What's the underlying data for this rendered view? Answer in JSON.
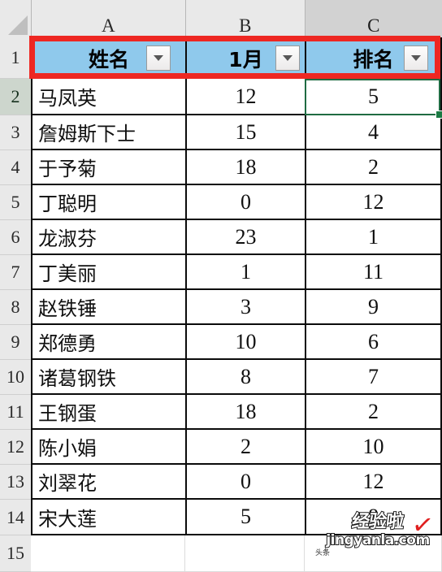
{
  "grid": {
    "column_headers": [
      "A",
      "B",
      "C"
    ],
    "selected_column_header": "C",
    "row_headers": [
      "1",
      "2",
      "3",
      "4",
      "5",
      "6",
      "7",
      "8",
      "9",
      "10",
      "11",
      "12",
      "13",
      "14",
      "15"
    ],
    "active_row_header": "2",
    "active_cell": "C2"
  },
  "table": {
    "header_fill_color": "#8FC9EC",
    "headers": [
      "姓名",
      "1月",
      "排名"
    ],
    "filter_button_icon": "chevron-down-icon",
    "rows": [
      {
        "name": "马凤英",
        "month": "12",
        "rank": "5"
      },
      {
        "name": "詹姆斯下士",
        "month": "15",
        "rank": "4"
      },
      {
        "name": "于予菊",
        "month": "18",
        "rank": "2"
      },
      {
        "name": "丁聪明",
        "month": "0",
        "rank": "12"
      },
      {
        "name": "龙淑芬",
        "month": "23",
        "rank": "1"
      },
      {
        "name": "丁美丽",
        "month": "1",
        "rank": "11"
      },
      {
        "name": "赵铁锤",
        "month": "3",
        "rank": "9"
      },
      {
        "name": "郑德勇",
        "month": "10",
        "rank": "6"
      },
      {
        "name": "诸葛钢铁",
        "month": "8",
        "rank": "7"
      },
      {
        "name": "王钢蛋",
        "month": "18",
        "rank": "2"
      },
      {
        "name": "陈小娟",
        "month": "2",
        "rank": "10"
      },
      {
        "name": "刘翠花",
        "month": "0",
        "rank": "12"
      },
      {
        "name": "宋大莲",
        "month": "5",
        "rank": "8"
      }
    ]
  },
  "annotation": {
    "shape": "rectangle",
    "color": "#EE2722",
    "target": "header row 1 (A1:C1)"
  },
  "selection": {
    "border_color": "#1F6B42",
    "fill_handle_color": "#1A7A43"
  },
  "watermark": {
    "brand": "经验啦",
    "check_mark": "✓",
    "site": "jingyanla.com",
    "tiny": "头条"
  }
}
